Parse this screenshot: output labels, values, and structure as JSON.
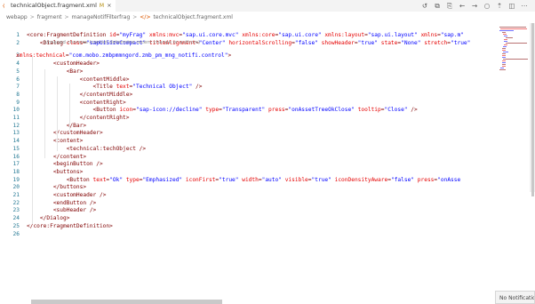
{
  "tab": {
    "icon": "xml-file-icon",
    "label": "technicalObject.fragment.xml",
    "modified": "M",
    "close": "×"
  },
  "actions": [
    "timeline-icon",
    "compare-icon",
    "open-changes-icon",
    "go-back-icon",
    "go-forward-icon",
    "circle-icon",
    "arrow-up-icon",
    "split-editor-icon",
    "more-icon"
  ],
  "breadcrumb": {
    "items": [
      "webapp",
      "fragment",
      "manageNotifFilterfrag",
      "technicalObject.fragment.xml"
    ],
    "separator": ">",
    "file_icon": "</>"
  },
  "editor": {
    "hint": "Unsaved changes (cannot determine recent change or authors)",
    "lines": [
      {
        "n": "1",
        "text": "<core:FragmentDefinition id=\"myFrag\" xmlns:mvc=\"sap.ui.core.mvc\" xmlns:core=\"sap.ui.core\" xmlns:layout=\"sap.ui.layout\" xmlns=\"sap.m\""
      },
      {
        "n": "2",
        "text": "    <Dialog class=\"sapUiSizeCompact\" titleAlignment=\"Center\" horizontalScrolling=\"false\" showHeader=\"true\" state=\"None\" stretch=\"true\""
      },
      {
        "n": "3",
        "text": "xmlns:technical=\"com.mobo.zmbpmmngord.zmb_pm_mng_notifi.control\">"
      },
      {
        "n": "4",
        "text": "        <customHeader>"
      },
      {
        "n": "5",
        "text": "            <Bar>"
      },
      {
        "n": "6",
        "text": "                <contentMiddle>"
      },
      {
        "n": "7",
        "text": "                    <Title text=\"Technical Object\" />"
      },
      {
        "n": "8",
        "text": "                </contentMiddle>"
      },
      {
        "n": "9",
        "text": "                <contentRight>"
      },
      {
        "n": "10",
        "text": "                    <Button icon=\"sap-icon://decline\" type=\"Transparent\" press=\"onAssetTreeOkClose\" tooltip=\"Close\" />"
      },
      {
        "n": "11",
        "text": "                </contentRight>"
      },
      {
        "n": "12",
        "text": "            </Bar>"
      },
      {
        "n": "13",
        "text": "        </customHeader>"
      },
      {
        "n": "14",
        "text": "        <content>"
      },
      {
        "n": "15",
        "text": "            <technical:techObject />"
      },
      {
        "n": "16",
        "text": "        </content>"
      },
      {
        "n": "17",
        "text": "        <beginButton />"
      },
      {
        "n": "18",
        "text": "        <buttons>"
      },
      {
        "n": "19",
        "text": "            <Button text=\"Ok\" type=\"Emphasized\" iconFirst=\"true\" width=\"auto\" visible=\"true\" iconDensityAware=\"false\" press=\"onAsse"
      },
      {
        "n": "20",
        "text": "        </buttons>"
      },
      {
        "n": "21",
        "text": "        <customHeader />"
      },
      {
        "n": "22",
        "text": "        <endButton />"
      },
      {
        "n": "23",
        "text": "        <subHeader />"
      },
      {
        "n": "24",
        "text": "    </Dialog>"
      },
      {
        "n": "25",
        "text": "</core:FragmentDefinition>"
      },
      {
        "n": "26",
        "text": ""
      }
    ]
  },
  "notification": {
    "text": "No Notificatio"
  },
  "colors": {
    "tag": "#800000",
    "attribute": "#e50000",
    "value": "#0000ff",
    "line_number": "#237893",
    "file_icon": "#e37933"
  }
}
